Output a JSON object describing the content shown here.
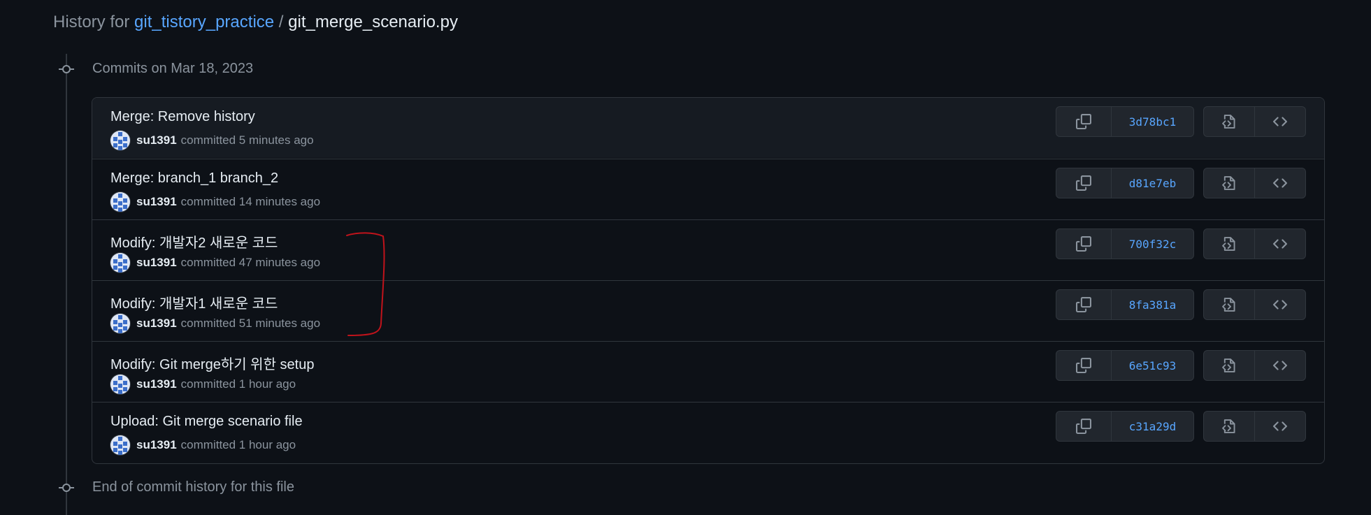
{
  "header": {
    "prefix": "History for",
    "repo_name": "git_tistory_practice",
    "separator": "/",
    "file_name": "git_merge_scenario.py"
  },
  "timeline": {
    "group_label": "Commits on Mar 18, 2023",
    "end_label": "End of commit history for this file"
  },
  "commits": [
    {
      "title": "Merge: Remove history",
      "author": "su1391",
      "time": "committed 5 minutes ago",
      "sha": "3d78bc1"
    },
    {
      "title": "Merge: branch_1 branch_2",
      "author": "su1391",
      "time": "committed 14 minutes ago",
      "sha": "d81e7eb"
    },
    {
      "title": "Modify: 개발자2 새로운 코드",
      "author": "su1391",
      "time": "committed 47 minutes ago",
      "sha": "700f32c"
    },
    {
      "title": "Modify: 개발자1 새로운 코드",
      "author": "su1391",
      "time": "committed 51 minutes ago",
      "sha": "8fa381a"
    },
    {
      "title": "Modify: Git merge하기 위한 setup",
      "author": "su1391",
      "time": "committed 1 hour ago",
      "sha": "6e51c93"
    },
    {
      "title": "Upload: Git merge scenario file",
      "author": "su1391",
      "time": "committed 1 hour ago",
      "sha": "c31a29d"
    }
  ],
  "icons": {
    "commit_node": "git-commit-icon",
    "copy": "copy-icon",
    "view_file": "file-code-icon",
    "browse_repo": "code-icon",
    "avatar": "avatar"
  },
  "colors": {
    "background": "#0d1117",
    "link": "#58a6ff",
    "muted": "#8b949e",
    "border": "#30363d",
    "annotation": "#c0131b"
  }
}
